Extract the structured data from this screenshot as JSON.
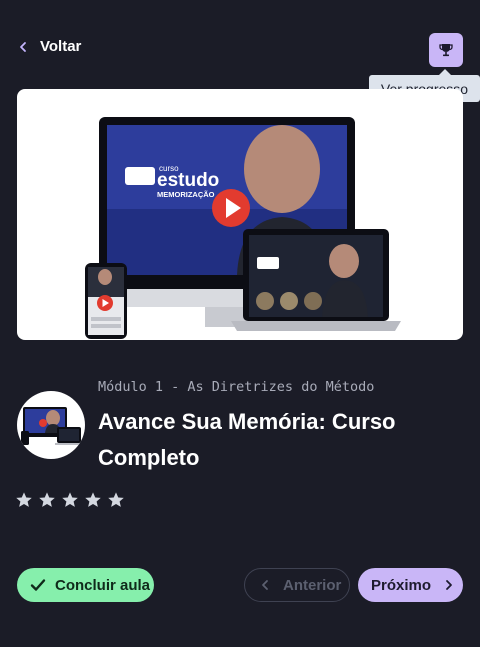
{
  "header": {
    "back_label": "Voltar",
    "tooltip": "Ver progresso"
  },
  "video": {
    "brand_small": "curso",
    "brand_big": "estudo",
    "brand_sub": "MEMORIZAÇÃO"
  },
  "lesson": {
    "module": "Módulo 1 - As Diretrizes do Método",
    "title": "Avance Sua Memória: Curso Completo",
    "rating": 0,
    "rating_max": 5
  },
  "actions": {
    "conclude": "Concluir aula",
    "previous": "Anterior",
    "next": "Próximo"
  },
  "colors": {
    "background": "#1b1c27",
    "accent": "#c9b6f7",
    "success": "#86efac"
  }
}
